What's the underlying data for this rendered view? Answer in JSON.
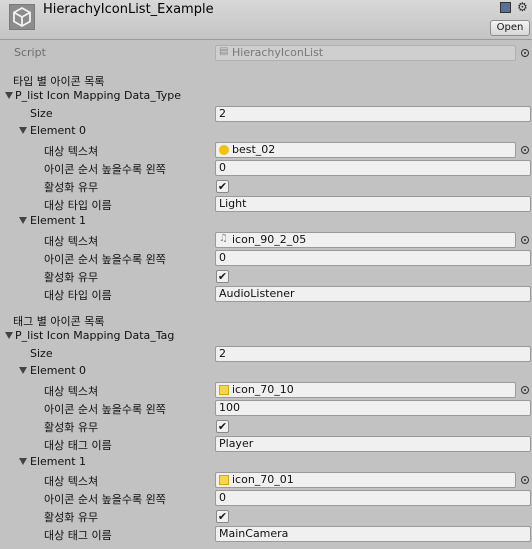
{
  "header": {
    "title": "HierachyIconList_Example",
    "open_label": "Open"
  },
  "script": {
    "label": "Script",
    "value": "HierachyIconList"
  },
  "type_section": {
    "heading": "타입 별 아이콘 목록",
    "list_label": "P_list Icon Mapping Data_Type",
    "size_label": "Size",
    "size_value": "2",
    "elements": [
      {
        "label": "Element 0",
        "texture_label": "대상 텍스쳐",
        "texture_value": "best_02",
        "order_label": "아이콘 순서 높을수록 왼쪽",
        "order_value": "0",
        "active_label": "활성화 유무",
        "active_checked": true,
        "name_label": "대상 타입 이름",
        "name_value": "Light"
      },
      {
        "label": "Element 1",
        "texture_label": "대상 텍스쳐",
        "texture_value": "icon_90_2_05",
        "order_label": "아이콘 순서 높을수록 왼쪽",
        "order_value": "0",
        "active_label": "활성화 유무",
        "active_checked": true,
        "name_label": "대상 타입 이름",
        "name_value": "AudioListener"
      }
    ]
  },
  "tag_section": {
    "heading": "태그 별 아이콘 목록",
    "list_label": "P_list Icon Mapping Data_Tag",
    "size_label": "Size",
    "size_value": "2",
    "elements": [
      {
        "label": "Element 0",
        "texture_label": "대상 텍스쳐",
        "texture_value": "icon_70_10",
        "order_label": "아이콘 순서 높을수록 왼쪽",
        "order_value": "100",
        "active_label": "활성화 유무",
        "active_checked": true,
        "name_label": "대상 태그 이름",
        "name_value": "Player"
      },
      {
        "label": "Element 1",
        "texture_label": "대상 텍스쳐",
        "texture_value": "icon_70_01",
        "order_label": "아이콘 순서 높을수록 왼쪽",
        "order_value": "0",
        "active_label": "활성화 유무",
        "active_checked": true,
        "name_label": "대상 태그 이름",
        "name_value": "MainCamera"
      }
    ]
  },
  "check_mark": "✔"
}
